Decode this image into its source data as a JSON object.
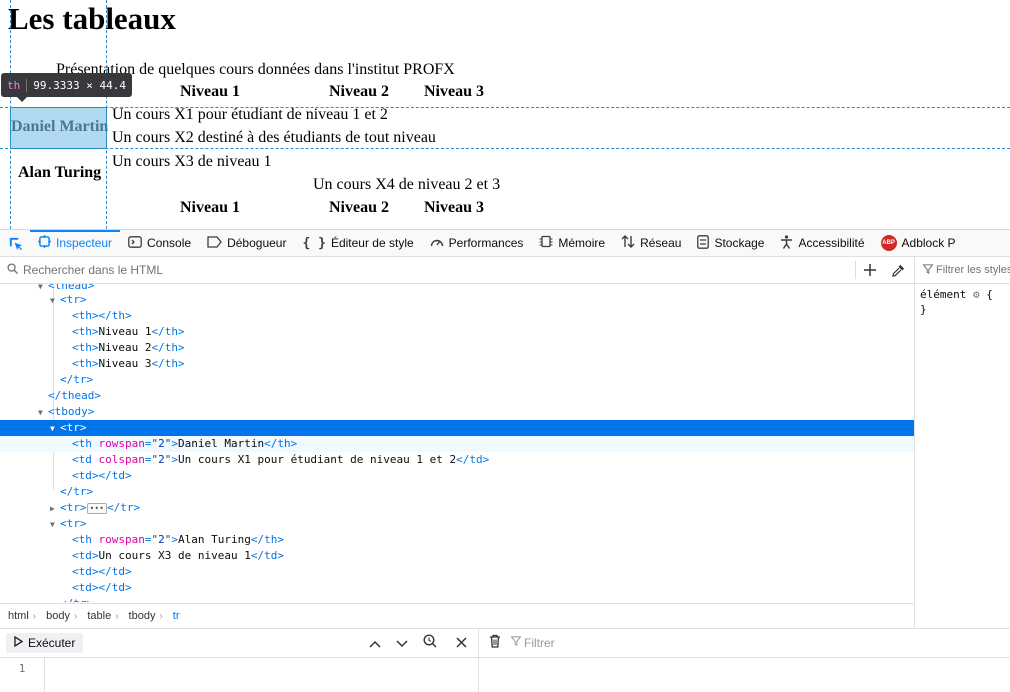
{
  "preview": {
    "title": "Les tableaux",
    "caption": "Présentation de quelques cours données dans l'institut PROFX",
    "header_row": [
      "Niveau 1",
      "Niveau 2",
      "Niveau 3"
    ],
    "footer_row": [
      "Niveau 1",
      "Niveau 2",
      "Niveau 3"
    ],
    "rows": {
      "daniel": "Daniel Martin",
      "cours_x1": "Un cours X1 pour étudiant de niveau 1 et 2",
      "cours_x2": "Un cours X2 destiné à des étudiants de tout niveau",
      "alan": "Alan Turing",
      "cours_x3": "Un cours X3 de niveau 1",
      "cours_x4": "Un cours X4 de niveau 2 et 3"
    },
    "highlight": {
      "tag": "th",
      "dimensions": "99.3333 × 44.4"
    }
  },
  "devtools": {
    "tabs": [
      {
        "label": "Inspecteur",
        "icon": "inspector-icon",
        "active": true
      },
      {
        "label": "Console",
        "icon": "console-icon"
      },
      {
        "label": "Débogueur",
        "icon": "debugger-icon"
      },
      {
        "label": "Éditeur de style",
        "icon": "style-editor-icon"
      },
      {
        "label": "Performances",
        "icon": "performance-icon"
      },
      {
        "label": "Mémoire",
        "icon": "memory-icon"
      },
      {
        "label": "Réseau",
        "icon": "network-icon"
      },
      {
        "label": "Stockage",
        "icon": "storage-icon"
      },
      {
        "label": "Accessibilité",
        "icon": "accessibility-icon"
      },
      {
        "label": "Adblock P",
        "icon": "adblock-icon"
      }
    ],
    "search_placeholder": "Rechercher dans le HTML",
    "filter_styles_placeholder": "Filtrer les styles",
    "rule": {
      "selector": "élément",
      "open": "{",
      "close": "}"
    },
    "breadcrumb": [
      "html",
      "body",
      "table",
      "tbody",
      "tr"
    ],
    "markup": {
      "thead_close_partial": "<thead>",
      "tr_open": "<tr>",
      "th_empty": "<th></th>",
      "th_n1": "Niveau 1",
      "th_n2": "Niveau 2",
      "th_n3": "Niveau 3",
      "tr_close": "</tr>",
      "thead_close": "</thead>",
      "tbody_open": "<tbody>",
      "rowspan_attr": "rowspan",
      "colspan_attr": "colspan",
      "attr_val_2": "\"2\"",
      "daniel": "Daniel Martin",
      "cours_x1": "Un cours X1 pour étudiant de niveau 1 et 2",
      "alan": "Alan Turing",
      "cours_x3": "Un cours X3 de niveau 1"
    },
    "console": {
      "run_label": "Exécuter",
      "filter_placeholder": "Filtrer",
      "line_number": "1"
    }
  },
  "colors": {
    "accent": "#0a84ff",
    "selection": "#0074e8",
    "tag": "#0074e8",
    "attr_name": "#dd00a9",
    "attr_value": "#003eaa",
    "guide": "#2a8cc9"
  }
}
